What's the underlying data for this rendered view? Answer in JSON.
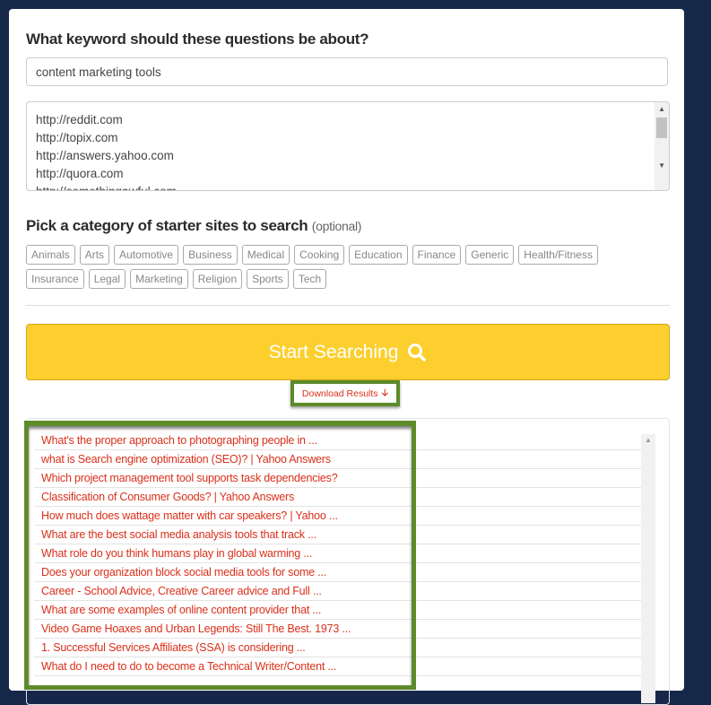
{
  "form": {
    "keyword_heading": "What keyword should these questions be about?",
    "keyword_value": "content marketing tools",
    "sites": [
      "http://reddit.com",
      "http://topix.com",
      "http://answers.yahoo.com",
      "http://quora.com",
      "http://somethingawful.com"
    ],
    "category_heading": "Pick a category of starter sites to search",
    "category_optional": "(optional)",
    "categories": [
      "Animals",
      "Arts",
      "Automotive",
      "Business",
      "Medical",
      "Cooking",
      "Education",
      "Finance",
      "Generic",
      "Health/Fitness",
      "Insurance",
      "Legal",
      "Marketing",
      "Religion",
      "Sports",
      "Tech"
    ],
    "search_button": "Start Searching",
    "download_label": "Download Results"
  },
  "results": [
    "What's the proper approach to photographing people in ...",
    "what is Search engine optimization (SEO)? | Yahoo Answers",
    "Which project management tool supports task dependencies?",
    "Classification of Consumer Goods? | Yahoo Answers",
    "How much does wattage matter with car speakers? | Yahoo ...",
    "What are the best social media analysis tools that track ...",
    "What role do you think humans play in global warming ...",
    "Does your organization block social media tools for some ...",
    "Career - School Advice, Creative Career advice and Full ...",
    "What are some examples of online content provider that ...",
    "Video Game Hoaxes and Urban Legends: Still The Best. 1973 ...",
    "1. Successful Services Affiliates (SSA) is considering ...",
    "What do I need to do to become a Technical Writer/Content ..."
  ],
  "colors": {
    "background": "#16284a",
    "button": "#fccf2e",
    "link": "#d9301a",
    "highlight": "#5d8b2a"
  }
}
